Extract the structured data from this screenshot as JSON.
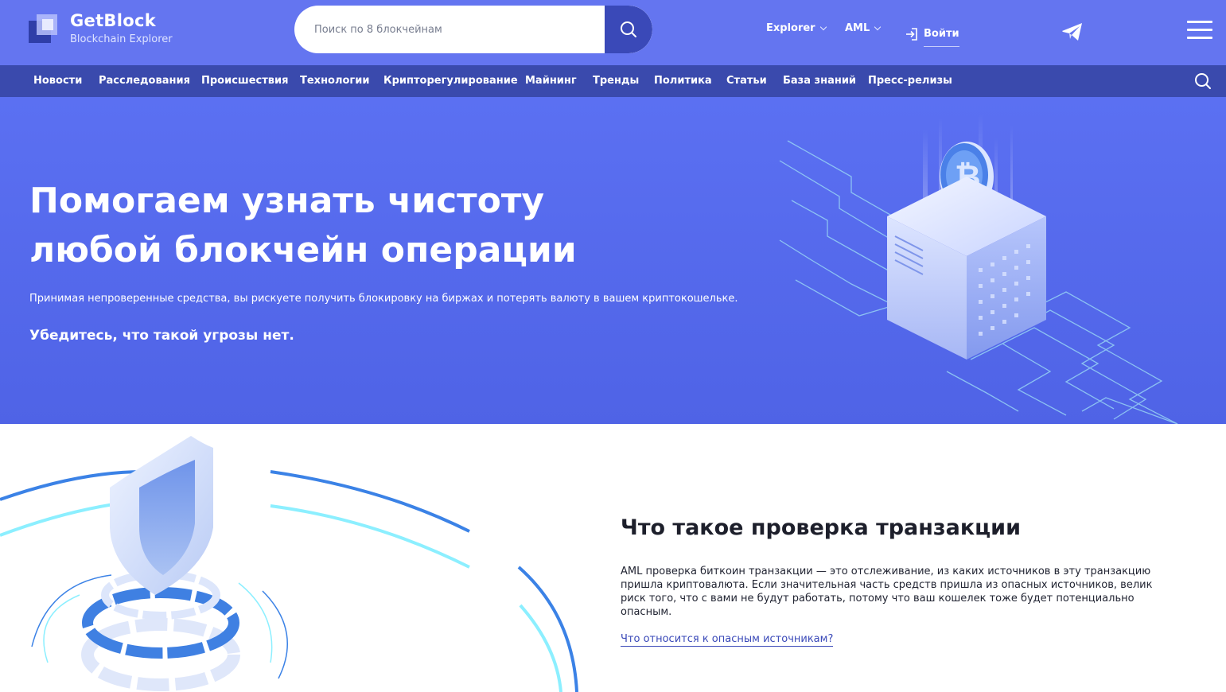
{
  "header": {
    "logo_title": "GetBlock",
    "logo_subtitle": "Blockchain Explorer",
    "search_placeholder": "Поиск по 8 блокчейнам",
    "nav": [
      {
        "label": "Explorer"
      },
      {
        "label": "AML"
      }
    ],
    "login_label": "Войти",
    "icons": [
      "search-icon",
      "chevron-down-icon",
      "login-icon",
      "telegram-icon",
      "menu-icon"
    ]
  },
  "categories": [
    {
      "label": "Новости"
    },
    {
      "label": "Расследования"
    },
    {
      "label": "Происшествия"
    },
    {
      "label": "Технологии"
    },
    {
      "label": "Крипторегулирование"
    },
    {
      "label": "Майнинг"
    },
    {
      "label": "Тренды"
    },
    {
      "label": "Политика"
    },
    {
      "label": "Статьи"
    },
    {
      "label": "База знаний"
    },
    {
      "label": "Пресс-релизы"
    }
  ],
  "hero": {
    "title_line1": "Помогаем узнать чистоту",
    "title_line2": "любой блокчейн операции",
    "text": "Принимая непроверенные средства, вы рискуете получить блокировку на биржах и потерять валюту в вашем криптокошельке.",
    "subtitle": "Убедитесь, что такой угрозы нет."
  },
  "info": {
    "title": "Что такое проверка транзакции",
    "text": "AML проверка биткоин транзакции — это отслеживание, из каких источников в эту транзакцию пришла криптовалюта. Если значительная часть средств пришла из опасных источников, велик риск того, что с вами не будут работать, потому что ваш кошелек тоже будет потенциально опасным.",
    "link": "Что относится к опасным источникам?"
  },
  "colors": {
    "header_bg": "#6475f0",
    "category_bar_bg": "#3a4aad",
    "hero_bg": "#5b70f2",
    "accent": "#3a49b8"
  }
}
